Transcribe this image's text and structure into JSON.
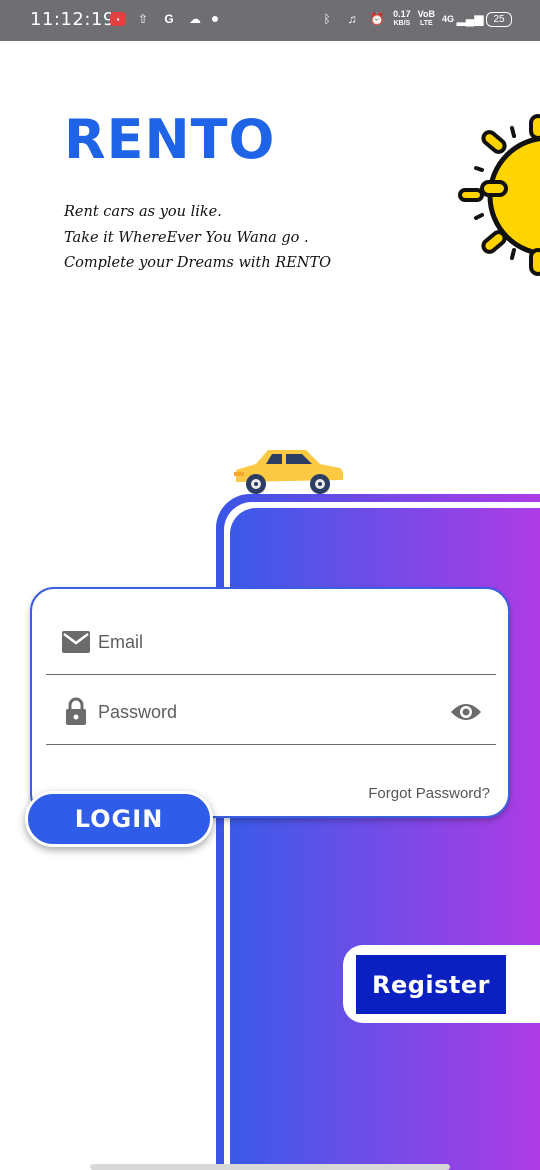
{
  "status_bar": {
    "time": "11:12:19",
    "speed_value": "0.17",
    "speed_unit": "KB/S",
    "volte": "VoB",
    "lte": "LTE",
    "network": "4G",
    "battery": "25",
    "icons": [
      "screen-record-icon",
      "upload-icon",
      "g-app-icon",
      "cloud-icon",
      "dot-icon",
      "bluetooth-icon",
      "headphones-icon",
      "alarm-icon",
      "signal-icon",
      "battery-icon"
    ]
  },
  "header": {
    "logo": "RENTO",
    "tagline": [
      "Rent cars as you like.",
      "Take it WhereEver You Wana go .",
      "Complete your Dreams with RENTO"
    ]
  },
  "login_form": {
    "email_placeholder": "Email",
    "password_placeholder": "Password",
    "forgot_password": "Forgot Password?",
    "login_label": "LOGIN"
  },
  "register": {
    "label": "Register"
  },
  "colors": {
    "brand_blue": "#1f63e6",
    "gradient_start": "#3a55e6",
    "gradient_end": "#b33ae8",
    "register_bg": "#0a20c0",
    "sun_yellow": "#ffd400"
  }
}
